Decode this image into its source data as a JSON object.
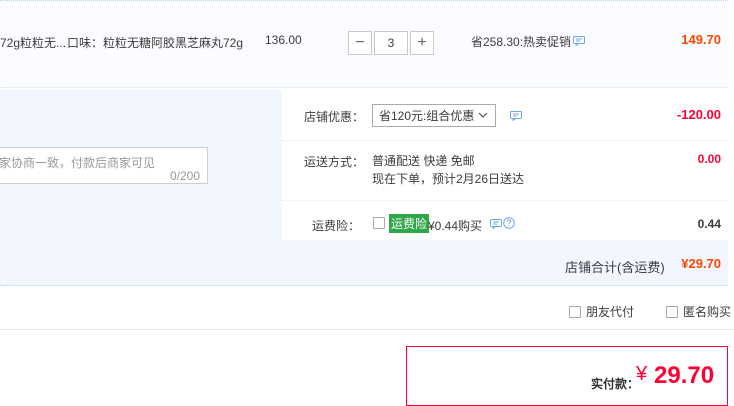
{
  "product": {
    "name": "72g粒粒无...",
    "spec": "口味：粒粒无糖阿胶黑芝麻丸72g",
    "unit_price": "136.00",
    "quantity": "3",
    "minus_label": "−",
    "plus_label": "+",
    "promo": "省258.30:热卖促销",
    "subtotal": "149.70"
  },
  "shop": {
    "discount_label": "店铺优惠：",
    "discount_selected": "省120元:组合优惠",
    "discount_amount": "-120.00",
    "shipping_label": "运送方式：",
    "shipping_method": "普通配送 快递 免邮",
    "shipping_eta": "现在下单，预计2月26日送达",
    "shipping_amount": "0.00",
    "insurance_label": "运费险：",
    "insurance_tag": "运费险",
    "insurance_price": "¥0.44购买",
    "insurance_amount": "0.44",
    "memo_placeholder": "家协商一致，付款后商家可见",
    "memo_counter": "0/200",
    "total_label": "店铺合计(含运费)",
    "total_amount": "¥29.70"
  },
  "options": {
    "friend_pay": "朋友代付",
    "anonymous": "匿名购买"
  },
  "payment": {
    "label": "实付款：",
    "currency": "¥",
    "amount": "29.70"
  },
  "colors": {
    "accent_red": "#ff0036",
    "accent_orange": "#ff4400",
    "section_bg": "#f2f7ff",
    "insurance_tag_bg": "#2fa948"
  },
  "icons": [
    "chat-icon",
    "chevron-down-icon",
    "help-icon",
    "checkbox"
  ]
}
